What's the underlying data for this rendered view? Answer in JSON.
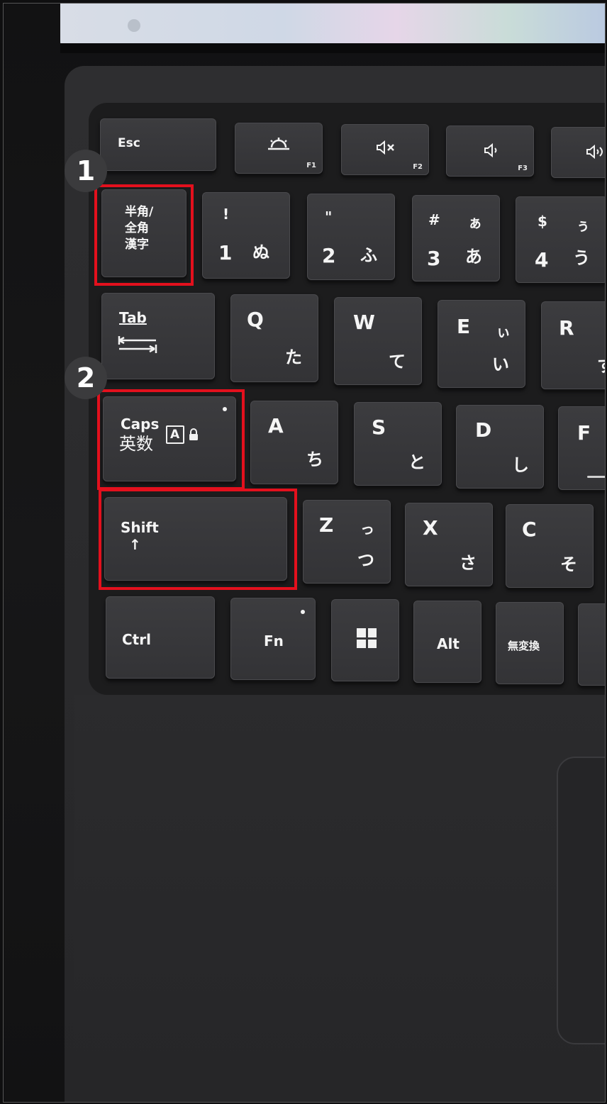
{
  "badges": {
    "one": "1",
    "two": "2"
  },
  "keys": {
    "esc": "Esc",
    "f1": "F1",
    "f2": "F2",
    "f3": "F3",
    "hankaku": "半角/\n全角\n漢字",
    "n1_top": "!",
    "n1_num": "1",
    "n1_kana": "ぬ",
    "n2_top": "\"",
    "n2_num": "2",
    "n2_kana": "ふ",
    "n3_top": "#",
    "n3_num": "3",
    "n3_kana_top": "ぁ",
    "n3_kana": "あ",
    "n4_top": "$",
    "n4_num": "4",
    "n4_kana_top": "ぅ",
    "n4_kana": "う",
    "tab": "Tab",
    "q": "Q",
    "q_kana": "た",
    "w": "W",
    "w_kana": "て",
    "e": "E",
    "e_kana_top": "ぃ",
    "e_kana": "い",
    "r": "R",
    "r_kana": "す",
    "caps": "Caps",
    "eisu": "英数",
    "caps_icon": "A",
    "a": "A",
    "a_kana": "ち",
    "s": "S",
    "s_kana": "と",
    "d": "D",
    "d_kana": "し",
    "f": "F",
    "shift": "Shift",
    "shift_arrow": "↑",
    "z": "Z",
    "z_kana_top": "っ",
    "z_kana": "つ",
    "x": "X",
    "x_kana": "さ",
    "c": "C",
    "c_kana": "そ",
    "ctrl": "Ctrl",
    "fn": "Fn",
    "alt": "Alt",
    "muhenkan": "無変換"
  },
  "icons": {
    "brightness": "brightness-icon",
    "mute": "mute-icon",
    "volume_down": "volume-down-icon",
    "volume_up": "volume-up-icon",
    "windows": "windows-logo-icon",
    "lock": "lock-icon"
  },
  "colors": {
    "highlight": "#e3101d",
    "badge": "#3b3b3d"
  }
}
